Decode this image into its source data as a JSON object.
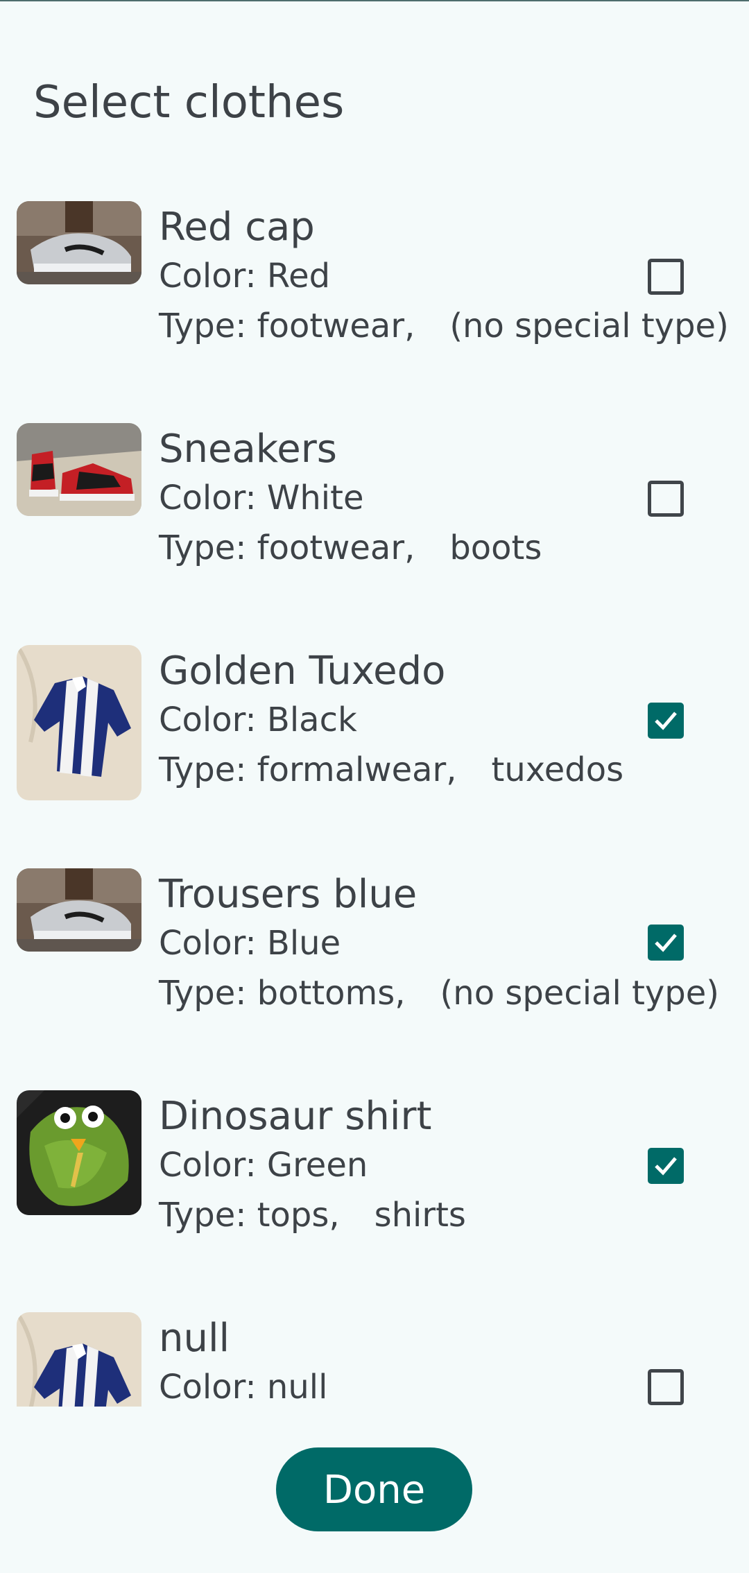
{
  "screen": {
    "title": "Select clothes",
    "accent_color": "#006a67"
  },
  "items": [
    {
      "name": "Red cap",
      "color_line": "Color: Red",
      "type_prefix": "Type: footwear,",
      "type_special": "(no special type)",
      "checked": false,
      "thumbnail_icon": "sneaker-photo-icon"
    },
    {
      "name": "Sneakers",
      "color_line": "Color: White",
      "type_prefix": "Type: footwear,",
      "type_special": "boots",
      "checked": false,
      "thumbnail_icon": "red-high-tops-photo-icon"
    },
    {
      "name": "Golden Tuxedo",
      "color_line": "Color: Black",
      "type_prefix": "Type: formalwear,",
      "type_special": "tuxedos",
      "checked": true,
      "thumbnail_icon": "striped-shirt-photo-icon"
    },
    {
      "name": "Trousers blue",
      "color_line": "Color: Blue",
      "type_prefix": "Type: bottoms,",
      "type_special": "(no special type)",
      "checked": true,
      "thumbnail_icon": "sneaker-photo-icon"
    },
    {
      "name": "Dinosaur shirt",
      "color_line": "Color: Green",
      "type_prefix": "Type: tops,",
      "type_special": "shirts",
      "checked": true,
      "thumbnail_icon": "dinosaur-costume-photo-icon"
    },
    {
      "name": "null",
      "color_line": "Color: null",
      "type_prefix": "",
      "type_special": "",
      "checked": false,
      "thumbnail_icon": "striped-shirt-photo-icon"
    }
  ],
  "footer": {
    "done_label": "Done"
  }
}
